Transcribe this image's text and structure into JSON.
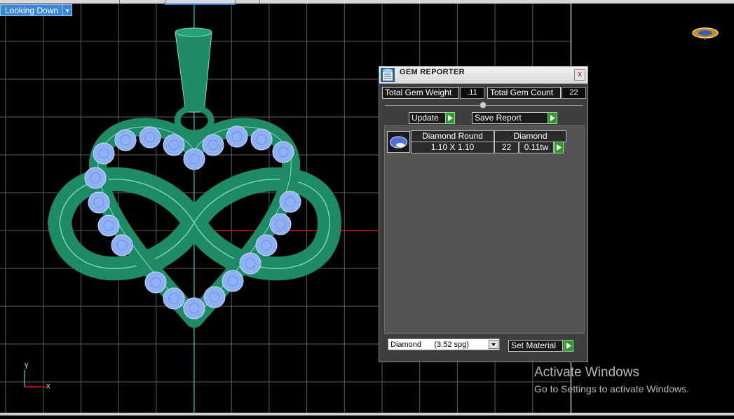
{
  "viewport": {
    "view_label": "Looking Down",
    "axis_y_label": "y",
    "axis_x_label": "x",
    "grid_color": "#5e5e5e",
    "axis_red": "#d01818",
    "axis_cyan": "#19b5b5",
    "model_color": "#1e8a66",
    "gem_color": "#8fb0f5"
  },
  "gem_reporter": {
    "title": "GEM REPORTER",
    "close_label": "x",
    "total_gem_weight_label": "Total Gem Weight",
    "total_gem_weight_value": ".11",
    "total_gem_count_label": "Total Gem Count",
    "total_gem_count_value": "22",
    "update_label": "Update",
    "save_report_label": "Save Report",
    "rows": [
      {
        "shape": "Diamond Round",
        "material": "Diamond",
        "size": "1.10 X 1.10",
        "count": "22",
        "weight": "0.11tw"
      }
    ],
    "material_select_value": "Diamond      (3.52 spg)",
    "set_material_label": "Set Material",
    "accent_green": "#2f9a2a"
  },
  "os_watermark": {
    "title": "Activate Windows",
    "subtitle": "Go to Settings to activate Windows."
  }
}
